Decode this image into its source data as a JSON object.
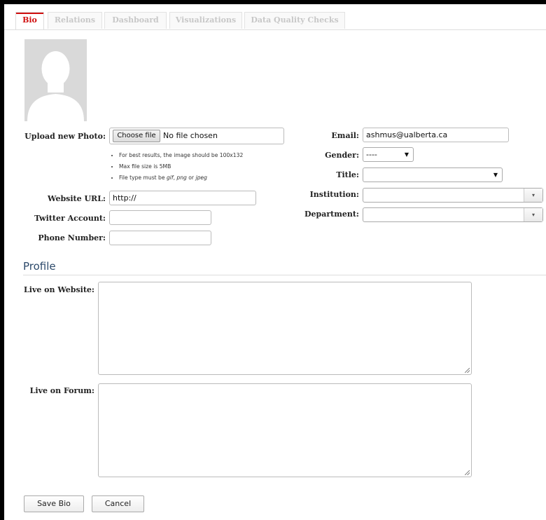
{
  "tabs": [
    {
      "label": "Bio",
      "active": true
    },
    {
      "label": "Relations"
    },
    {
      "label": "Dashboard"
    },
    {
      "label": "Visualizations"
    },
    {
      "label": "Data Quality Checks"
    }
  ],
  "photo": {
    "upload_label": "Upload new Photo:",
    "choose_button": "Choose file",
    "file_status": "No file chosen",
    "hints": [
      "For best results, the image should be 100x132",
      "Max file size is 5MB",
      "File type must be gif, png or jpeg"
    ]
  },
  "fields": {
    "website_label": "Website URL:",
    "website_value": "http://",
    "twitter_label": "Twitter Account:",
    "twitter_value": "",
    "phone_label": "Phone Number:",
    "phone_value": "",
    "email_label": "Email:",
    "email_value": "ashmus@ualberta.ca",
    "gender_label": "Gender:",
    "gender_value": "----",
    "title_label": "Title:",
    "title_value": "",
    "institution_label": "Institution:",
    "institution_value": "",
    "department_label": "Department:",
    "department_value": ""
  },
  "profile": {
    "section_title": "Profile",
    "live_website_label": "Live on Website:",
    "live_forum_label": "Live on Forum:"
  },
  "actions": {
    "save_label": "Save Bio",
    "cancel_label": "Cancel"
  },
  "colors": {
    "active_tab": "#d01010",
    "section_title": "#2d4a6b"
  }
}
